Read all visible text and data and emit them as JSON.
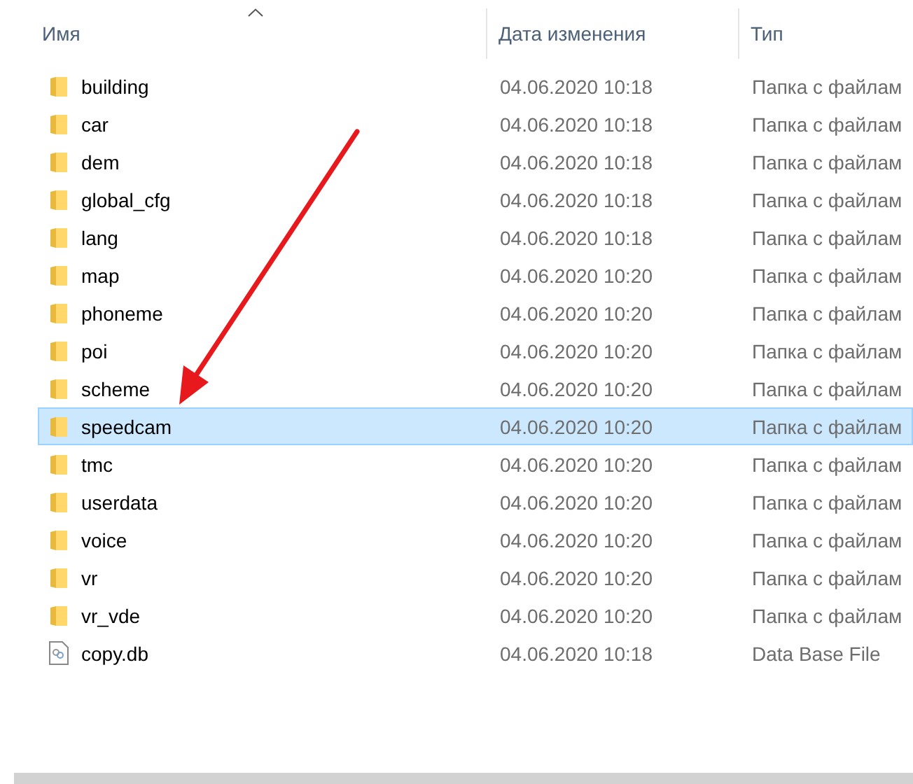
{
  "columns": [
    {
      "label": "Имя",
      "sorted": true
    },
    {
      "label": "Дата изменения",
      "sorted": false
    },
    {
      "label": "Тип",
      "sorted": false
    }
  ],
  "rows": [
    {
      "kind": "folder",
      "name": "building",
      "date": "04.06.2020 10:18",
      "type": "Папка с файлам",
      "selected": false
    },
    {
      "kind": "folder",
      "name": "car",
      "date": "04.06.2020 10:18",
      "type": "Папка с файлам",
      "selected": false
    },
    {
      "kind": "folder",
      "name": "dem",
      "date": "04.06.2020 10:18",
      "type": "Папка с файлам",
      "selected": false
    },
    {
      "kind": "folder",
      "name": "global_cfg",
      "date": "04.06.2020 10:18",
      "type": "Папка с файлам",
      "selected": false
    },
    {
      "kind": "folder",
      "name": "lang",
      "date": "04.06.2020 10:18",
      "type": "Папка с файлам",
      "selected": false
    },
    {
      "kind": "folder",
      "name": "map",
      "date": "04.06.2020 10:20",
      "type": "Папка с файлам",
      "selected": false
    },
    {
      "kind": "folder",
      "name": "phoneme",
      "date": "04.06.2020 10:20",
      "type": "Папка с файлам",
      "selected": false
    },
    {
      "kind": "folder",
      "name": "poi",
      "date": "04.06.2020 10:20",
      "type": "Папка с файлам",
      "selected": false
    },
    {
      "kind": "folder",
      "name": "scheme",
      "date": "04.06.2020 10:20",
      "type": "Папка с файлам",
      "selected": false
    },
    {
      "kind": "folder",
      "name": "speedcam",
      "date": "04.06.2020 10:20",
      "type": "Папка с файлам",
      "selected": true
    },
    {
      "kind": "folder",
      "name": "tmc",
      "date": "04.06.2020 10:20",
      "type": "Папка с файлам",
      "selected": false
    },
    {
      "kind": "folder",
      "name": "userdata",
      "date": "04.06.2020 10:20",
      "type": "Папка с файлам",
      "selected": false
    },
    {
      "kind": "folder",
      "name": "voice",
      "date": "04.06.2020 10:20",
      "type": "Папка с файлам",
      "selected": false
    },
    {
      "kind": "folder",
      "name": "vr",
      "date": "04.06.2020 10:20",
      "type": "Папка с файлам",
      "selected": false
    },
    {
      "kind": "folder",
      "name": "vr_vde",
      "date": "04.06.2020 10:20",
      "type": "Папка с файлам",
      "selected": false
    },
    {
      "kind": "file",
      "name": "copy.db",
      "date": "04.06.2020 10:18",
      "type": "Data Base File",
      "selected": false
    }
  ]
}
